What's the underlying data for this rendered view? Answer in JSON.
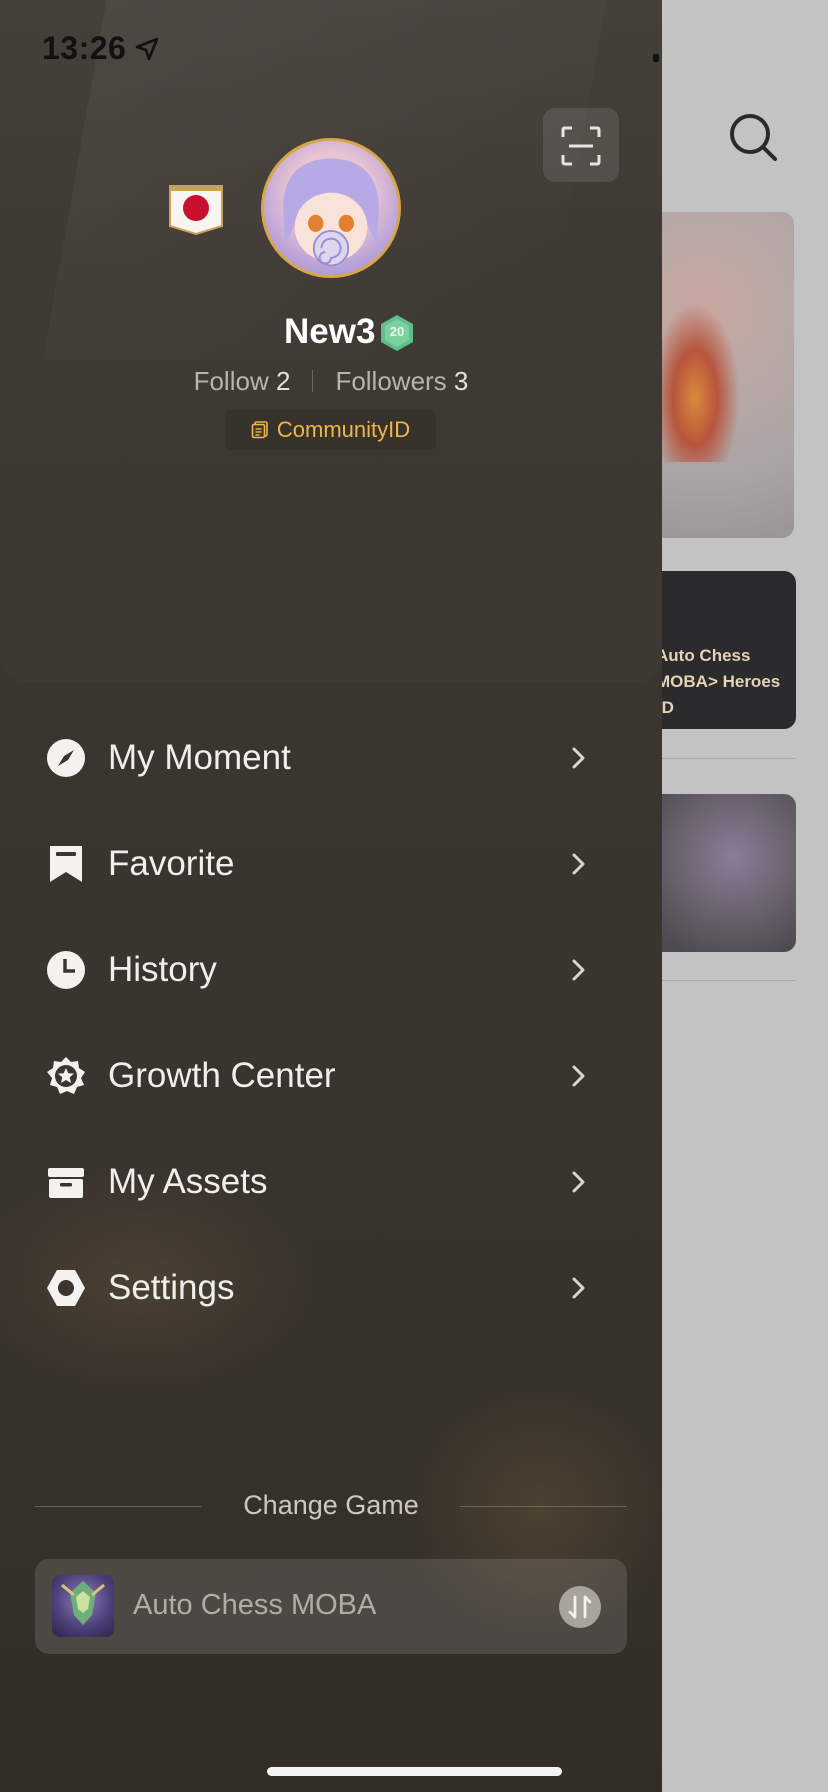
{
  "status_bar": {
    "time": "13:26"
  },
  "background_app": {
    "card2_text": "Auto Chess MOBA> Heroes  [D"
  },
  "profile": {
    "username": "New3",
    "level": "20",
    "follow_label": "Follow",
    "follow_count": "2",
    "followers_label": "Followers",
    "followers_count": "3",
    "community_id": "CommunityID"
  },
  "menu": {
    "items": [
      {
        "label": "My Moment",
        "icon": "compass-icon"
      },
      {
        "label": "Favorite",
        "icon": "bookmark-icon"
      },
      {
        "label": "History",
        "icon": "clock-icon"
      },
      {
        "label": "Growth Center",
        "icon": "star-badge-icon"
      },
      {
        "label": "My Assets",
        "icon": "archive-box-icon"
      },
      {
        "label": "Settings",
        "icon": "hexagon-settings-icon"
      }
    ]
  },
  "change_game": {
    "title": "Change Game",
    "current_game": "Auto Chess MOBA"
  },
  "colors": {
    "accent_gold": "#f0b54a",
    "badge_green": "#5fbf8b",
    "drawer_bg": "#3b352f"
  }
}
